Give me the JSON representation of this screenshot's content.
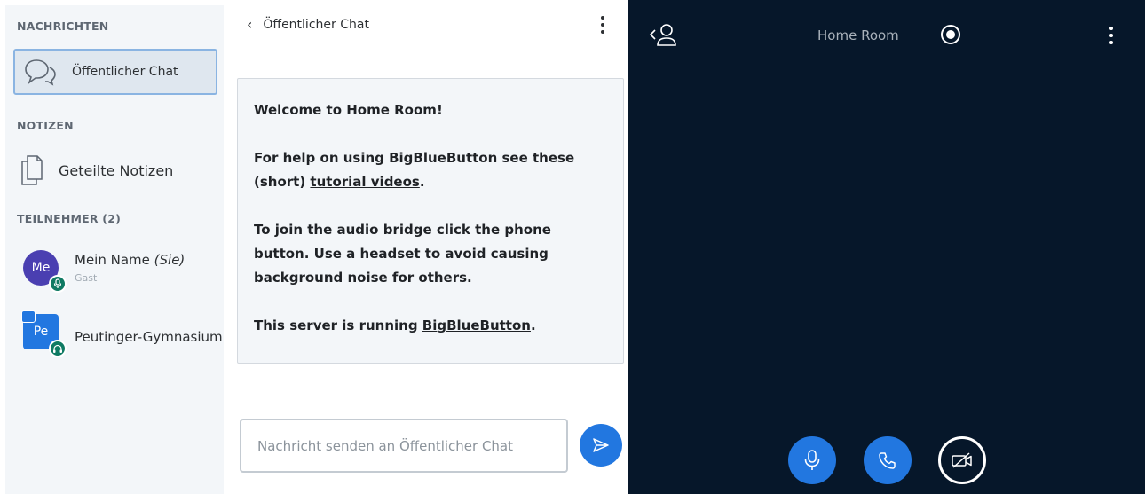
{
  "userlist": {
    "messages_title": "NACHRICHTEN",
    "public_chat_label": "Öffentlicher Chat",
    "notes_title": "NOTIZEN",
    "shared_notes_label": "Geteilte Notizen",
    "participants_title": "TEILNEHMER (2)",
    "users": [
      {
        "initials": "Me",
        "name": "Mein Name",
        "self_tag": "(Sie)",
        "role": "Gast",
        "badge_icon": "microphone-icon"
      },
      {
        "initials": "Pe",
        "name": "Peutinger-Gymnasium",
        "badge_icon": "headphones-icon",
        "presenter_icon": "presenter-icon"
      }
    ]
  },
  "chat": {
    "title": "Öffentlicher Chat",
    "welcome": {
      "line1_prefix": "Welcome to ",
      "line1_room": "Home Room",
      "line1_suffix": "!",
      "help_prefix": "For help on using BigBlueButton see these (short) ",
      "help_link": "tutorial videos",
      "help_suffix": ".",
      "audio_text": "To join the audio bridge click the phone button. Use a headset to avoid causing background noise for others.",
      "server_prefix": "This server is running ",
      "server_link": "BigBlueButton",
      "server_suffix": "."
    },
    "input_placeholder": "Nachricht senden an Öffentlicher Chat"
  },
  "media": {
    "room_title": "Home Room"
  },
  "colors": {
    "accent_blue": "#2277e0",
    "media_background": "#06172a",
    "avatar_purple": "#4a3fb1",
    "badge_green": "#0f7a63"
  }
}
